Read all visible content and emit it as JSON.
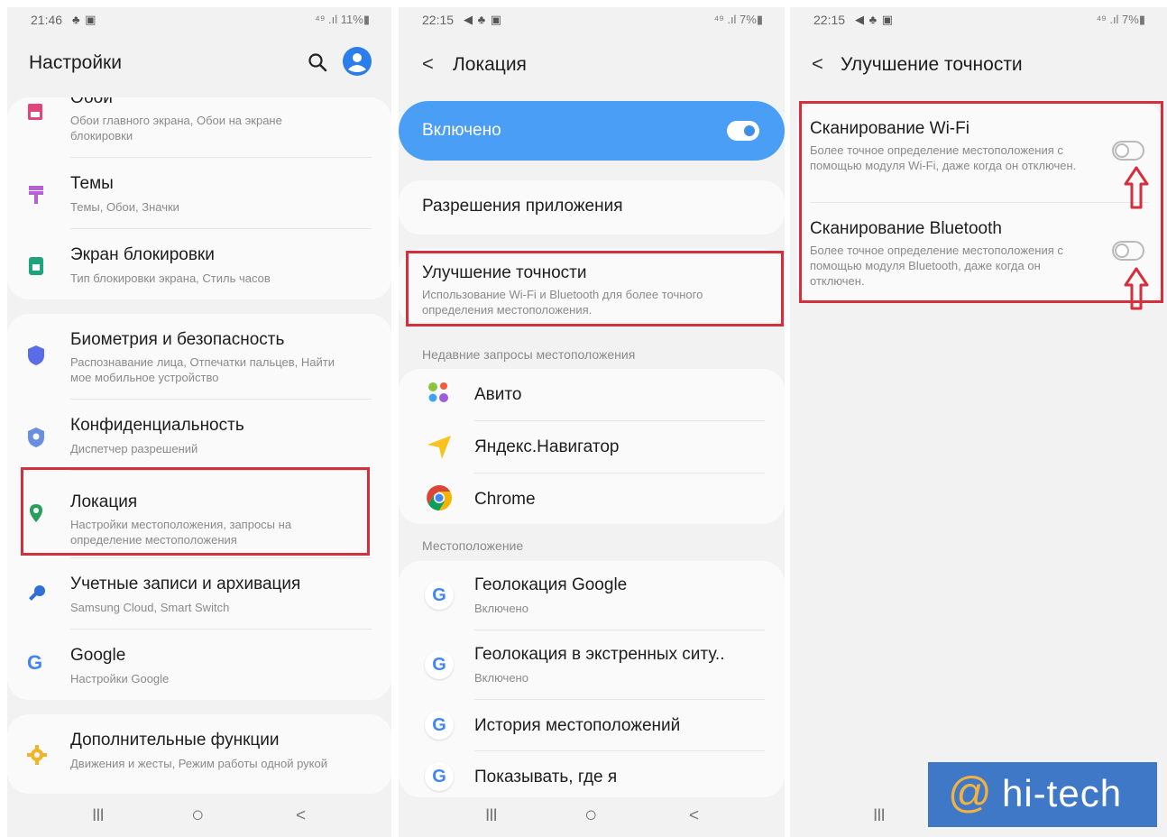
{
  "screen1": {
    "status": {
      "time": "21:46",
      "icons": "♣ ▣",
      "right": "⁴⁹ .ıl 11%▮"
    },
    "title": "Настройки",
    "items": [
      {
        "title": "Обои",
        "sub": "Обои главного экрана, Обои на экране блокировки"
      },
      {
        "title": "Темы",
        "sub": "Темы, Обои, Значки"
      },
      {
        "title": "Экран блокировки",
        "sub": "Тип блокировки экрана, Стиль часов"
      },
      {
        "title": "Биометрия и безопасность",
        "sub": "Распознавание лица, Отпечатки пальцев, Найти мое мобильное устройство"
      },
      {
        "title": "Конфиденциальность",
        "sub": "Диспетчер разрешений"
      },
      {
        "title": "Локация",
        "sub": "Настройки местоположения, запросы на определение местоположения"
      },
      {
        "title": "Учетные записи и архивация",
        "sub": "Samsung Cloud, Smart Switch"
      },
      {
        "title": "Google",
        "sub": "Настройки Google"
      },
      {
        "title": "Дополнительные функции",
        "sub": "Движения и жесты, Режим работы одной рукой"
      }
    ]
  },
  "screen2": {
    "status": {
      "time": "22:15",
      "icons": "◀ ♣ ▣",
      "right": "⁴⁹ .ıl 7%▮"
    },
    "title": "Локация",
    "enabled_label": "Включено",
    "permissions": "Разрешения приложения",
    "accuracy": {
      "title": "Улучшение точности",
      "sub": "Использование Wi-Fi и Bluetooth для более точного определения местоположения."
    },
    "recent_label": "Недавние запросы местоположения",
    "recent": [
      "Авито",
      "Яндекс.Навигатор",
      "Chrome"
    ],
    "location_label": "Местоположение",
    "services": [
      {
        "title": "Геолокация Google",
        "sub": "Включено"
      },
      {
        "title": "Геолокация в экстренных ситу..",
        "sub": "Включено"
      },
      {
        "title": "История местоположений",
        "sub": ""
      },
      {
        "title": "Показывать, где я",
        "sub": ""
      }
    ]
  },
  "screen3": {
    "status": {
      "time": "22:15",
      "icons": "◀ ♣ ▣",
      "right": "⁴⁹ .ıl 7%▮"
    },
    "title": "Улучшение точности",
    "wifi": {
      "title": "Сканирование Wi-Fi",
      "sub": "Более точное определение местоположения с помощью модуля Wi-Fi, даже когда он отключен."
    },
    "bt": {
      "title": "Сканирование Bluetooth",
      "sub": "Более точное определение местоположения с помощью модуля Bluetooth, даже когда он отключен."
    }
  },
  "nav": {
    "recents": "III",
    "home": "○",
    "back": "<"
  },
  "watermark": {
    "at": "@",
    "text": "hi-tech"
  },
  "colors": {
    "accent": "#4a9ef5",
    "highlight": "#d32f3c",
    "watermark_bg": "#3f78c7",
    "watermark_at": "#f3b23f"
  }
}
